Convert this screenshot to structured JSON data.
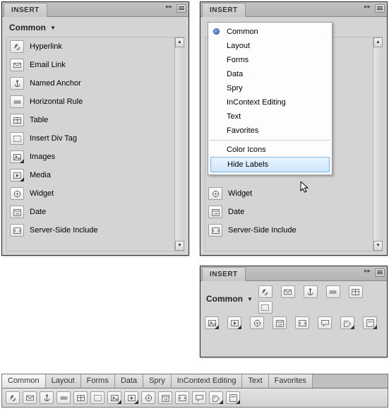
{
  "panel_title": "INSERT",
  "category_label": "Common",
  "items": [
    {
      "label": "Hyperlink",
      "icon": "link"
    },
    {
      "label": "Email Link",
      "icon": "mail"
    },
    {
      "label": "Named Anchor",
      "icon": "anchor"
    },
    {
      "label": "Horizontal Rule",
      "icon": "hr"
    },
    {
      "label": "Table",
      "icon": "table"
    },
    {
      "label": "Insert Div Tag",
      "icon": "div"
    },
    {
      "label": "Images",
      "icon": "image",
      "dropdown": true
    },
    {
      "label": "Media",
      "icon": "media",
      "dropdown": true
    },
    {
      "label": "Widget",
      "icon": "widget"
    },
    {
      "label": "Date",
      "icon": "date"
    },
    {
      "label": "Server-Side Include",
      "icon": "ssi"
    }
  ],
  "menu": {
    "groups": [
      [
        "Common",
        "Layout",
        "Forms",
        "Data",
        "Spry",
        "InContext Editing",
        "Text",
        "Favorites"
      ],
      [
        "Color Icons",
        "Hide Labels"
      ]
    ],
    "selected": "Common",
    "highlighted": "Hide Labels"
  },
  "visible_under_menu": [
    "Widget",
    "Date",
    "Server-Side Include"
  ],
  "tabs": [
    "Common",
    "Layout",
    "Forms",
    "Data",
    "Spry",
    "InContext Editing",
    "Text",
    "Favorites"
  ],
  "active_tab": "Common"
}
